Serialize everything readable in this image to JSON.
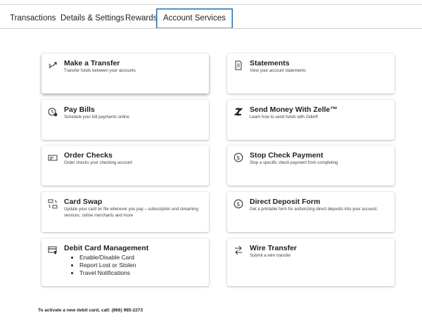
{
  "tabs": [
    {
      "label": "Transactions"
    },
    {
      "label": "Details & Settings"
    },
    {
      "label": "Rewards"
    },
    {
      "label": "Account Services",
      "active": true
    }
  ],
  "services": {
    "transfer": {
      "title": "Make a Transfer",
      "desc": "Transfer funds between your accounts",
      "icon": "transfer-icon"
    },
    "statements": {
      "title": "Statements",
      "desc": "View your account statements",
      "icon": "document-icon"
    },
    "pay_bills": {
      "title": "Pay Bills",
      "desc": "Schedule your bill payments online",
      "icon": "bill-clock-icon"
    },
    "zelle": {
      "title": "Send Money With Zelle™",
      "desc": "Learn how to send funds with Zelle®",
      "icon": "zelle-icon"
    },
    "order_checks": {
      "title": "Order Checks",
      "desc": "Order checks your checking account",
      "icon": "check-icon"
    },
    "stop_check": {
      "title": "Stop Check Payment",
      "desc": "Stop a specific check payment from completing",
      "icon": "dollar-circle-icon"
    },
    "card_swap": {
      "title": "Card Swap",
      "desc": "Update your card on file wherever you pay – subscription and streaming services, online merchants and more",
      "icon": "card-swap-icon"
    },
    "direct_deposit": {
      "title": "Direct Deposit Form",
      "desc": "Get a printable form for authorizing direct deposits into your account.",
      "icon": "dollar-circle-icon"
    },
    "debit_card": {
      "title": "Debit Card Management",
      "items": [
        "Enable/Disable Card",
        "Report Lost or Stolen",
        "Travel Notifications"
      ],
      "icon": "debit-card-shield-icon"
    },
    "wire": {
      "title": "Wire Transfer",
      "desc": "Submit a wire transfer",
      "icon": "wire-transfer-icon"
    }
  },
  "footer": {
    "activate_text": "To activate a new debit card, call: (866) 985-2273"
  },
  "colors": {
    "active_tab_border": "#1f6fb3",
    "text": "#1c1c1c"
  }
}
